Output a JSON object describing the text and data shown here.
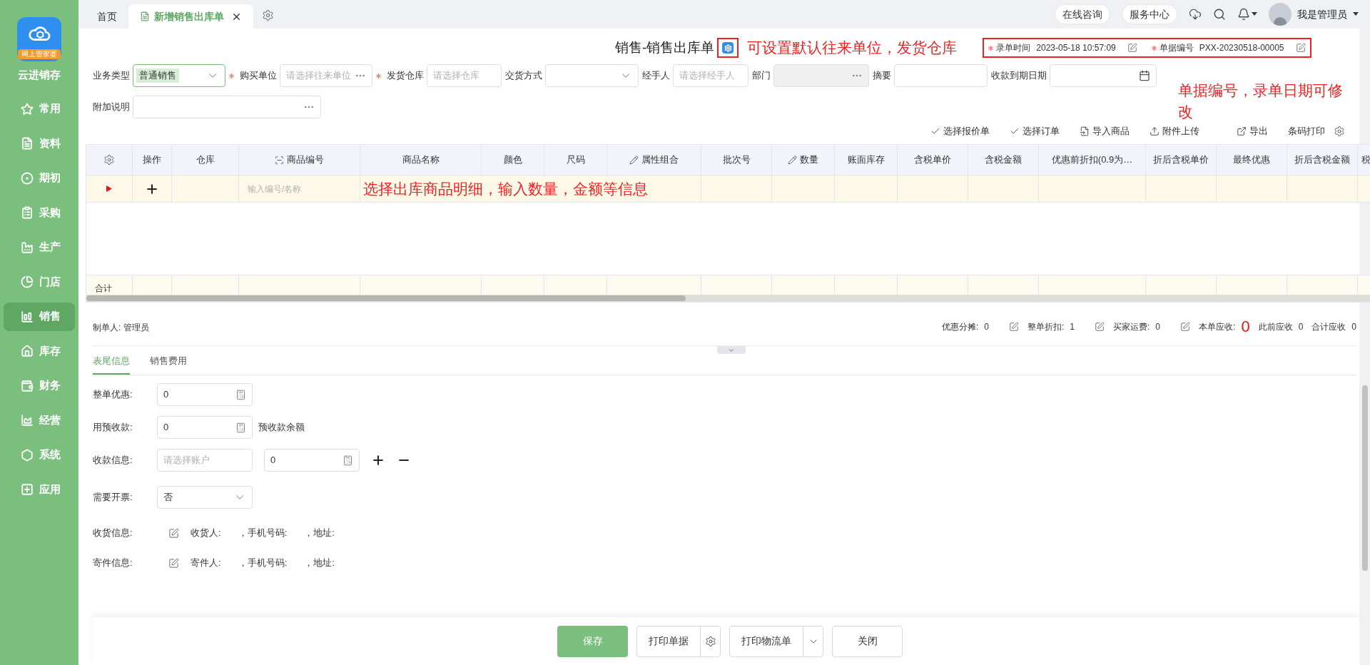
{
  "app": {
    "name": "云进销存",
    "logo_badge": "网上管家婆"
  },
  "sidebar": {
    "items": [
      {
        "label": "常用",
        "selected": false
      },
      {
        "label": "资料",
        "selected": false
      },
      {
        "label": "期初",
        "selected": false
      },
      {
        "label": "采购",
        "selected": false
      },
      {
        "label": "生产",
        "selected": false
      },
      {
        "label": "门店",
        "selected": false
      },
      {
        "label": "销售",
        "selected": true
      },
      {
        "label": "库存",
        "selected": false
      },
      {
        "label": "财务",
        "selected": false
      },
      {
        "label": "经营",
        "selected": false
      },
      {
        "label": "系统",
        "selected": false
      },
      {
        "label": "应用",
        "selected": false
      }
    ]
  },
  "tabs": [
    {
      "label": "首页",
      "selected": false,
      "closable": false
    },
    {
      "label": "新增销售出库单",
      "selected": true,
      "closable": true
    }
  ],
  "top_bar": {
    "buttons": [
      "在线咨询",
      "服务中心"
    ],
    "user": "我是管理员"
  },
  "page_title": "销售-销售出库单",
  "annotations": {
    "title_note": "可设置默认往来单位，发货仓库",
    "meta_note": "单据编号，录单日期可修改",
    "table_note": "选择出库商品明细，输入数量，金额等信息"
  },
  "meta": [
    {
      "label": "录单时间",
      "value": "2023-05-18 10:57:09",
      "required": true
    },
    {
      "label": "单据编号",
      "value": "PXX-20230518-00005",
      "required": true
    }
  ],
  "form_fields": [
    {
      "label": "业务类型",
      "kind": "select",
      "value": "普通销售",
      "required": false,
      "focused": true,
      "disabled": false
    },
    {
      "label": "购买单位",
      "kind": "picker",
      "placeholder": "请选择往来单位",
      "required": true,
      "focused": false,
      "disabled": false
    },
    {
      "label": "发货仓库",
      "kind": "text",
      "placeholder": "请选择仓库",
      "required": true,
      "focused": false,
      "disabled": false
    },
    {
      "label": "交货方式",
      "kind": "select",
      "required": false,
      "focused": false,
      "disabled": false
    },
    {
      "label": "经手人",
      "kind": "text",
      "placeholder": "请选择经手人",
      "required": false,
      "focused": false,
      "disabled": false
    },
    {
      "label": "部门",
      "kind": "picker",
      "required": false,
      "focused": false,
      "disabled": true
    },
    {
      "label": "摘要",
      "kind": "text",
      "required": false,
      "focused": false,
      "disabled": false
    },
    {
      "label": "收款到期日期",
      "kind": "date",
      "required": false,
      "focused": false,
      "disabled": false
    },
    {
      "label": "附加说明",
      "kind": "picker",
      "required": false,
      "focused": false,
      "disabled": false
    }
  ],
  "toolbar": [
    {
      "label": "选择报价单",
      "kind": "check"
    },
    {
      "label": "选择订单",
      "kind": "check"
    },
    {
      "label": "导入商品",
      "kind": "import"
    },
    {
      "label": "附件上传",
      "kind": "upload"
    },
    {
      "label": "导出",
      "kind": "export"
    },
    {
      "label": "条码打印",
      "kind": "plain"
    }
  ],
  "table": {
    "columns": [
      {
        "label": "操作",
        "kind": "plain"
      },
      {
        "label": "仓库",
        "kind": "plain"
      },
      {
        "label": "商品编号",
        "kind": "scan"
      },
      {
        "label": "商品名称",
        "kind": "plain"
      },
      {
        "label": "颜色",
        "kind": "plain"
      },
      {
        "label": "尺码",
        "kind": "plain"
      },
      {
        "label": "属性组合",
        "kind": "edit"
      },
      {
        "label": "批次号",
        "kind": "plain"
      },
      {
        "label": "数量",
        "kind": "edit"
      },
      {
        "label": "账面库存",
        "kind": "plain"
      },
      {
        "label": "含税单价",
        "kind": "plain"
      },
      {
        "label": "含税金额",
        "kind": "plain"
      },
      {
        "label": "优惠前折扣(0.9为…",
        "kind": "plain"
      },
      {
        "label": "折后含税单价",
        "kind": "plain"
      },
      {
        "label": "最终优惠",
        "kind": "plain"
      },
      {
        "label": "折后含税金额",
        "kind": "plain"
      },
      {
        "label": "税",
        "kind": "plain"
      }
    ],
    "entry_placeholder": "输入编号/名称",
    "total_label": "合计"
  },
  "creator": "制单人: 管理员",
  "summary": [
    {
      "label": "优惠分摊:",
      "value": "0",
      "kind": "editable"
    },
    {
      "label": "整单折扣:",
      "value": "1",
      "kind": "editable"
    },
    {
      "label": "买家运费:",
      "value": "0",
      "kind": "editable"
    },
    {
      "label": "本单应收:",
      "value": "0",
      "kind": "highlight"
    },
    {
      "label": "此前应收",
      "value": "0",
      "kind": "plain"
    },
    {
      "label": "合计应收",
      "value": "0",
      "kind": "plain"
    }
  ],
  "bottom_tabs": [
    {
      "label": "表尾信息",
      "selected": true
    },
    {
      "label": "销售费用",
      "selected": false
    }
  ],
  "footer_form": [
    {
      "label": "整单优惠:",
      "kind": "number",
      "value": "0"
    },
    {
      "label": "用预收款:",
      "kind": "number",
      "value": "0",
      "note": "预收款余额"
    },
    {
      "label": "收款信息:",
      "kind": "account",
      "placeholder": "请选择账户",
      "value": "0"
    },
    {
      "label": "需要开票:",
      "kind": "select",
      "value": "否"
    },
    {
      "label": "收货信息:",
      "kind": "contact",
      "parts": [
        "收货人:",
        "，手机号码:",
        "，地址:"
      ]
    },
    {
      "label": "寄件信息:",
      "kind": "contact",
      "parts": [
        "寄件人:",
        "，手机号码:",
        "，地址:"
      ]
    }
  ],
  "actions": [
    {
      "label": "保存",
      "kind": "primary"
    },
    {
      "label": "打印单据",
      "kind": "settings"
    },
    {
      "label": "打印物流单",
      "kind": "dropdown"
    },
    {
      "label": "关闭",
      "kind": "plain"
    }
  ]
}
